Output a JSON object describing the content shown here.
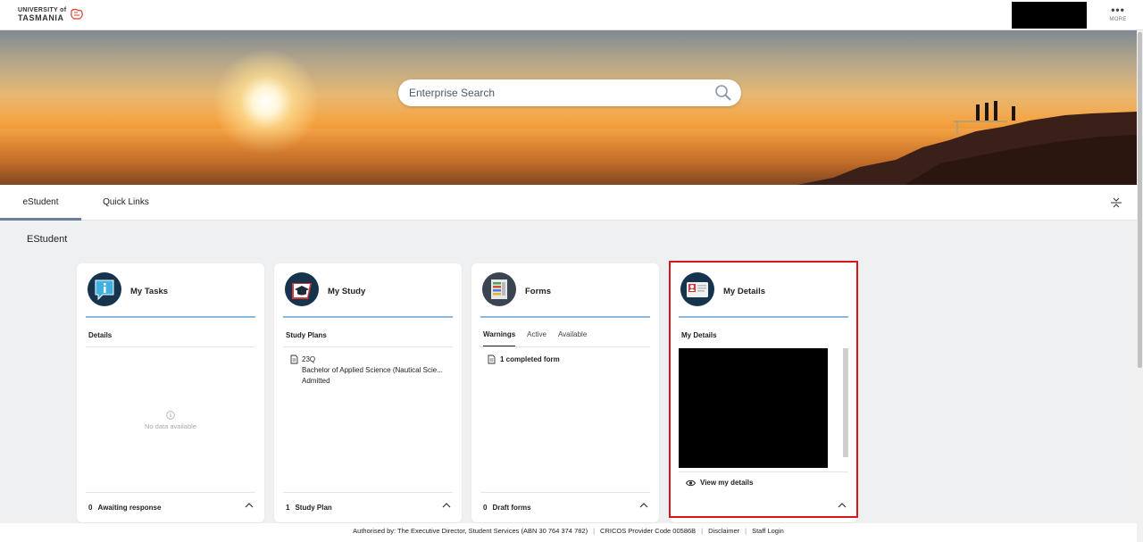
{
  "header": {
    "logo_line1": "UNIVERSITY of",
    "logo_line2": "TASMANIA",
    "more_label": "MORE"
  },
  "search": {
    "placeholder": "Enterprise Search"
  },
  "tabs": [
    {
      "label": "eStudent",
      "active": true
    },
    {
      "label": "Quick Links",
      "active": false
    }
  ],
  "section_title": "EStudent",
  "cards": {
    "tasks": {
      "title": "My Tasks",
      "subheading": "Details",
      "empty_text": "No data available",
      "footer_count": "0",
      "footer_label": "Awaiting response"
    },
    "study": {
      "title": "My Study",
      "subheading": "Study Plans",
      "plan_code": "23Q",
      "plan_name": "Bachelor of Applied Science (Nautical Scie...",
      "plan_status": "Admitted",
      "footer_count": "1",
      "footer_label": "Study Plan"
    },
    "forms": {
      "title": "Forms",
      "subtabs": [
        "Warnings",
        "Active",
        "Available"
      ],
      "item": "1 completed form",
      "footer_count": "0",
      "footer_label": "Draft forms"
    },
    "details": {
      "title": "My Details",
      "subheading": "My Details",
      "link": "View my details"
    }
  },
  "footer": {
    "authorised": "Authorised by:  The Executive Director, Student Services (ABN 30 764 374 782)",
    "cricos": "CRICOS Provider Code 00586B",
    "disclaimer": "Disclaimer",
    "staff_login": "Staff Login"
  },
  "colors": {
    "accent_rule": "#8cb8dc",
    "icon_bg": "#17344f",
    "highlight": "#d9141b",
    "tab_underline": "#6b7f9a"
  }
}
